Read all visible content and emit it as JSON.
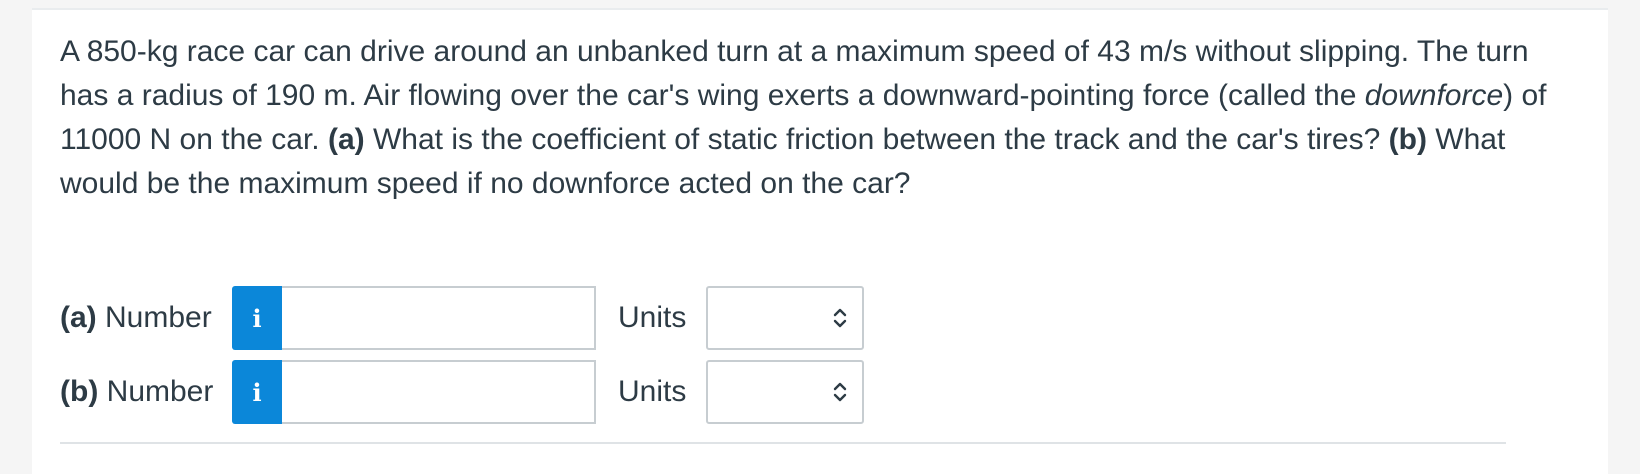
{
  "question": {
    "part1": "A 850-kg race car can drive around an unbanked turn at a maximum speed of 43 m/s without slipping. The turn has a radius of 190 m. Air flowing over the car's wing exerts a downward-pointing force (called the ",
    "italic": "downforce",
    "part2": ") of 11000 N on the car. ",
    "a_tag": "(a)",
    "a_text": " What is the coefficient of static friction between the track and the car's tires? ",
    "b_tag": "(b)",
    "b_text": " What would be the maximum speed if no downforce acted on the car?"
  },
  "answers": [
    {
      "tag": "(a)",
      "label": " Number",
      "info_icon": "i",
      "value": "",
      "units_label": "Units",
      "units_value": ""
    },
    {
      "tag": "(b)",
      "label": " Number",
      "info_icon": "i",
      "value": "",
      "units_label": "Units",
      "units_value": ""
    }
  ],
  "colors": {
    "info_button": "#0b87d9",
    "text": "#2d3b45",
    "border": "#c7cdd1"
  }
}
